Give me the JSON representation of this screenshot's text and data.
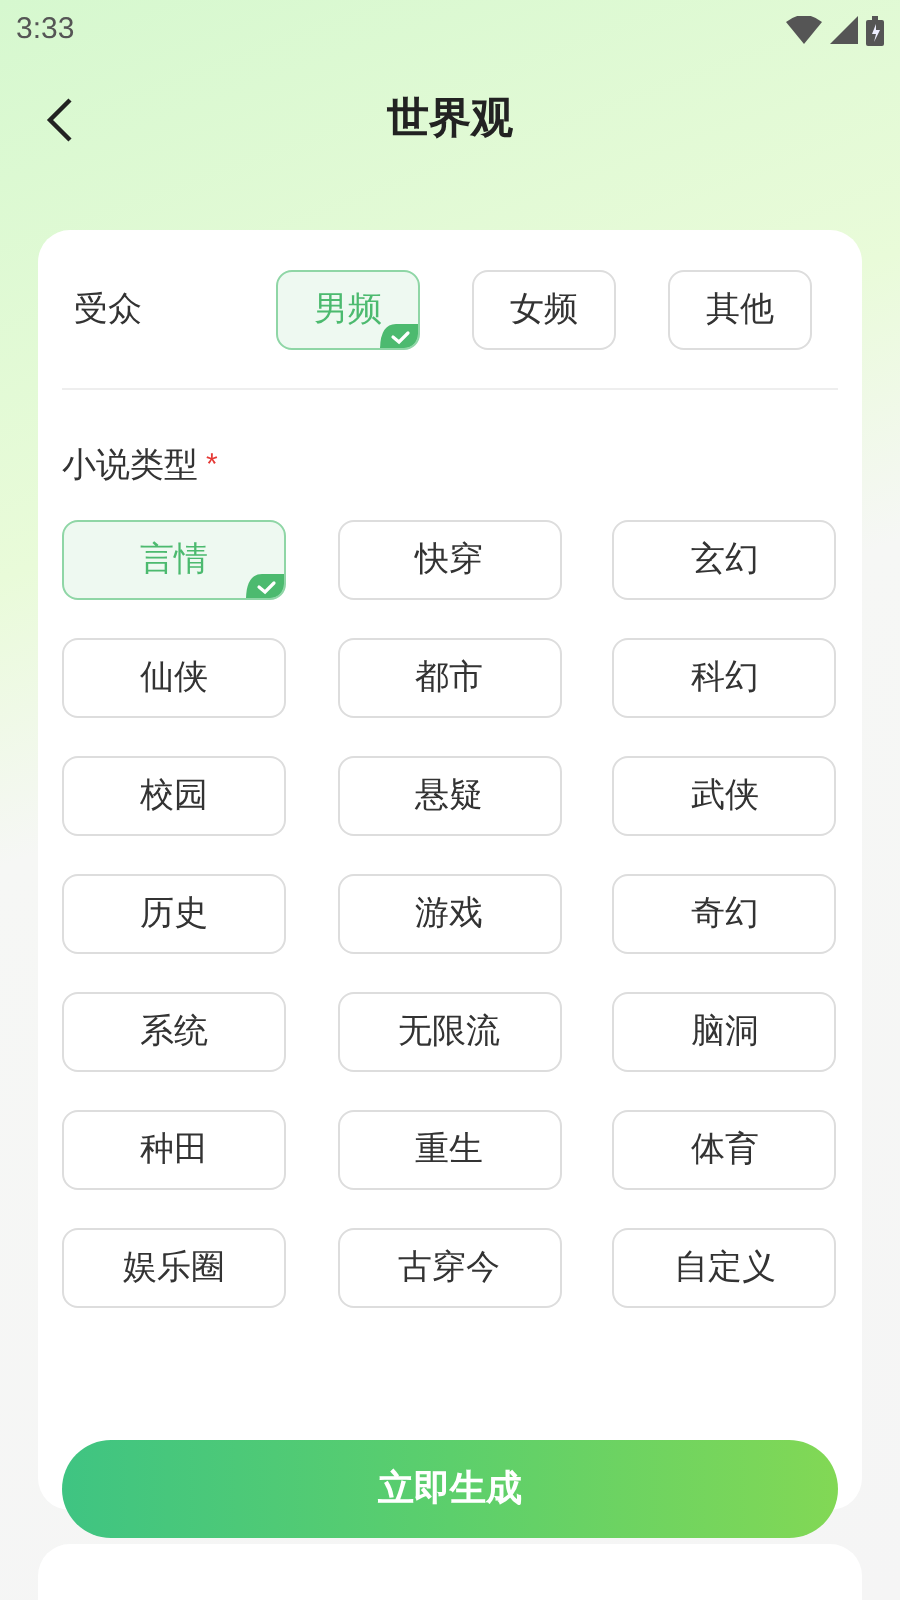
{
  "status_bar": {
    "time": "3:33"
  },
  "header": {
    "title": "世界观"
  },
  "audience": {
    "label": "受众",
    "options": [
      {
        "label": "男频",
        "selected": true
      },
      {
        "label": "女频",
        "selected": false
      },
      {
        "label": "其他",
        "selected": false
      }
    ]
  },
  "genre": {
    "label": "小说类型",
    "required_mark": "*",
    "options": [
      {
        "label": "言情",
        "selected": true
      },
      {
        "label": "快穿",
        "selected": false
      },
      {
        "label": "玄幻",
        "selected": false
      },
      {
        "label": "仙侠",
        "selected": false
      },
      {
        "label": "都市",
        "selected": false
      },
      {
        "label": "科幻",
        "selected": false
      },
      {
        "label": "校园",
        "selected": false
      },
      {
        "label": "悬疑",
        "selected": false
      },
      {
        "label": "武侠",
        "selected": false
      },
      {
        "label": "历史",
        "selected": false
      },
      {
        "label": "游戏",
        "selected": false
      },
      {
        "label": "奇幻",
        "selected": false
      },
      {
        "label": "系统",
        "selected": false
      },
      {
        "label": "无限流",
        "selected": false
      },
      {
        "label": "脑洞",
        "selected": false
      },
      {
        "label": "种田",
        "selected": false
      },
      {
        "label": "重生",
        "selected": false
      },
      {
        "label": "体育",
        "selected": false
      },
      {
        "label": "娱乐圈",
        "selected": false
      },
      {
        "label": "古穿今",
        "selected": false
      },
      {
        "label": "自定义",
        "selected": false
      }
    ]
  },
  "generate_button": "立即生成"
}
